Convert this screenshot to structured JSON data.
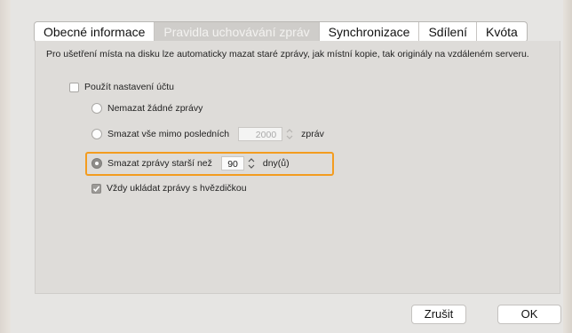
{
  "tabs": [
    {
      "label": "Obecné informace"
    },
    {
      "label": "Pravidla uchovávání zpráv"
    },
    {
      "label": "Synchronizace"
    },
    {
      "label": "Sdílení"
    },
    {
      "label": "Kvóta"
    }
  ],
  "description": "Pro ušetření místa na disku lze automaticky mazat staré zprávy, jak místní kopie, tak originály na vzdáleném serveru.",
  "use_account_settings": {
    "label": "Použít nastavení účtu",
    "checked": false
  },
  "options": {
    "keep_all": {
      "label": "Nemazat žádné zprávy"
    },
    "keep_last": {
      "label": "Smazat vše mimo posledních",
      "value": "2000",
      "unit": "zpráv"
    },
    "delete_older": {
      "label": "Smazat zprávy starší než",
      "value": "90",
      "unit": "dny(ů)",
      "selected": true
    }
  },
  "keep_starred": {
    "label": "Vždy ukládat zprávy s hvězdičkou",
    "checked": true
  },
  "buttons": {
    "cancel": "Zrušit",
    "ok": "OK"
  },
  "colors": {
    "highlight": "#f39c1f"
  }
}
